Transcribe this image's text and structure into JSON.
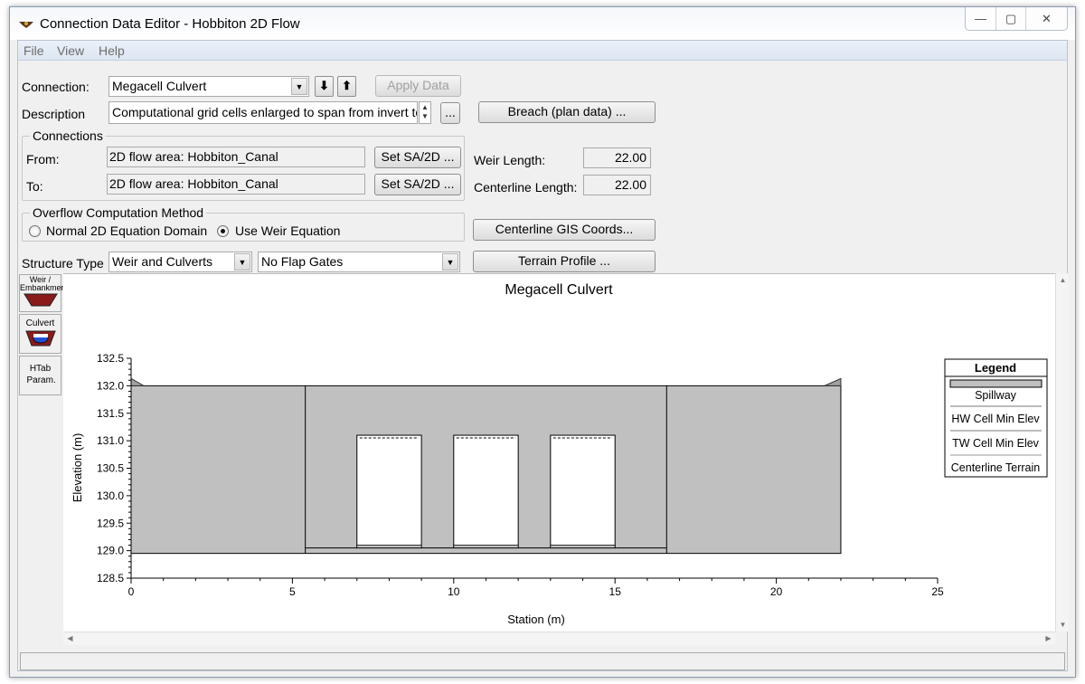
{
  "window": {
    "title": "Connection Data Editor - Hobbiton 2D Flow",
    "minimize_glyph": "—",
    "maximize_glyph": "▢",
    "close_glyph": "✕"
  },
  "menu": {
    "file": "File",
    "view": "View",
    "help": "Help"
  },
  "connection": {
    "label": "Connection:",
    "value": "Megacell Culvert",
    "down_glyph": "⬇",
    "up_glyph": "⬆",
    "apply_label": "Apply Data"
  },
  "description": {
    "label": "Description",
    "value": "Computational grid cells enlarged to span from invert to",
    "more_label": "...",
    "breach_label": "Breach (plan data) ..."
  },
  "connections_group": {
    "title": "Connections",
    "from_label": "From:",
    "from_value": "2D flow area: Hobbiton_Canal",
    "to_label": "To:",
    "to_value": "2D flow area: Hobbiton_Canal",
    "set_label": "Set SA/2D ..."
  },
  "weir_length": {
    "label": "Weir Length:",
    "value": "22.00"
  },
  "centerline_length": {
    "label": "Centerline Length:",
    "value": "22.00"
  },
  "overflow": {
    "title": "Overflow Computation Method",
    "option1": "Normal 2D Equation Domain",
    "option2": "Use Weir Equation",
    "selected": "Use Weir Equation"
  },
  "buttons": {
    "centerline_gis": "Centerline GIS Coords...",
    "terrain_profile": "Terrain Profile ..."
  },
  "structure": {
    "label": "Structure Type",
    "type_value": "Weir and Culverts",
    "flap_value": "No Flap Gates"
  },
  "side_tabs": {
    "weir": "Weir / Embankment",
    "culvert": "Culvert",
    "htab": "HTab Param."
  },
  "legend": {
    "title": "Legend",
    "items": [
      "Spillway",
      "HW Cell Min Elev",
      "TW Cell Min Elev",
      "Centerline Terrain"
    ]
  },
  "colors": {
    "embankment_fill": "#c0c0c0",
    "culvert_opening": "#ffffff",
    "weir_icon": "#8b1a1a",
    "culvert_icon_water": "#1f4fd6"
  },
  "chart_data": {
    "type": "area",
    "title": "Megacell Culvert",
    "xlabel": "Station (m)",
    "ylabel": "Elevation (m)",
    "xlim": [
      0,
      25
    ],
    "ylim": [
      128.5,
      132.5
    ],
    "x_ticks": [
      "0",
      "5",
      "10",
      "15",
      "20",
      "25"
    ],
    "y_ticks": [
      "128.5",
      "129.0",
      "129.5",
      "130.0",
      "130.5",
      "131.0",
      "131.5",
      "132.0",
      "132.5"
    ],
    "weir_profile": {
      "x": [
        0,
        22
      ],
      "top": 132.0,
      "bottom": 128.95
    },
    "structure_lines_x": [
      5.4,
      16.6
    ],
    "terrain": {
      "x": [
        5.4,
        16.6
      ],
      "y": [
        129.05,
        129.05
      ]
    },
    "culverts": [
      {
        "x_left": 7.0,
        "x_right": 9.0,
        "invert": 129.05,
        "top": 131.1
      },
      {
        "x_left": 10.0,
        "x_right": 12.0,
        "invert": 129.05,
        "top": 131.1
      },
      {
        "x_left": 13.0,
        "x_right": 15.0,
        "invert": 129.05,
        "top": 131.1
      }
    ],
    "legend_placement": "right"
  }
}
